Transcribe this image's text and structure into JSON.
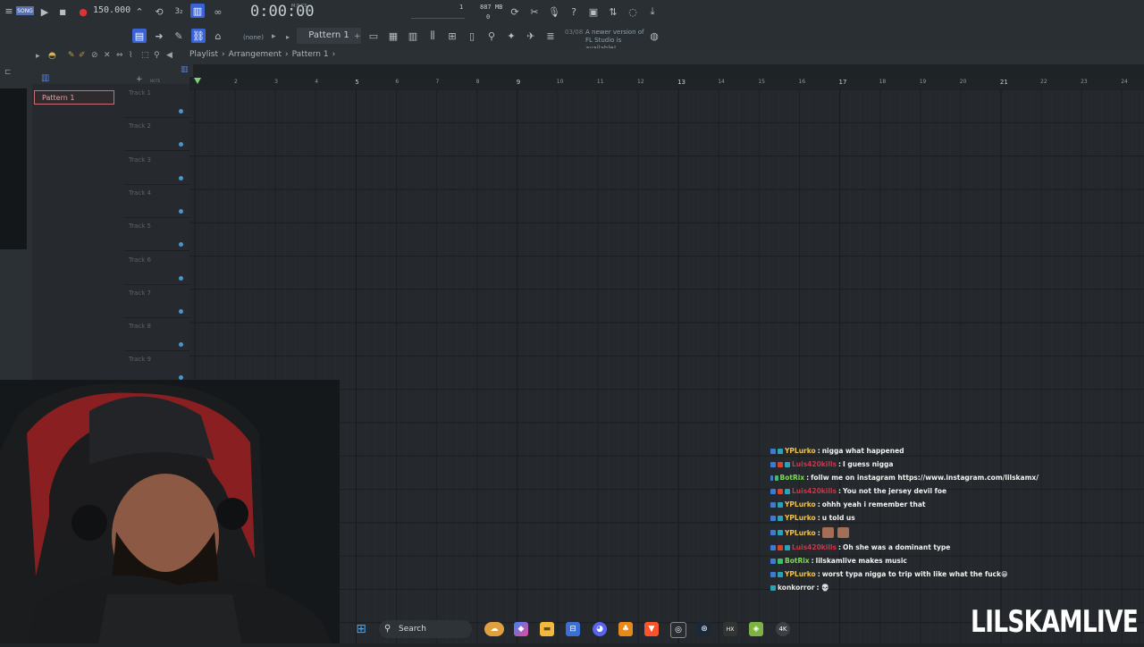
{
  "toolbar": {
    "mode_label": "SONG",
    "tempo": "150.000",
    "time_display": "0:00:00",
    "time_mode": "M:S:CS",
    "cpu_value": "1",
    "ram_label": "887 MB",
    "poly_value": "0",
    "pattern_selector": "Pattern 1",
    "snap_value": "(none)",
    "update_note_date": "03/08",
    "update_note_text": "A newer version of FL Studio is available!"
  },
  "playlist": {
    "breadcrumb": [
      "Playlist",
      "Arrangement",
      "Pattern 1"
    ],
    "pattern_items": [
      "Pattern 1"
    ],
    "tracks": [
      "Track 1",
      "Track 2",
      "Track 3",
      "Track 4",
      "Track 5",
      "Track 6",
      "Track 7",
      "Track 8",
      "Track 9"
    ],
    "bars": [
      "2",
      "3",
      "4",
      "5",
      "6",
      "7",
      "8",
      "9",
      "10",
      "11",
      "12",
      "13",
      "14",
      "15",
      "16",
      "17",
      "18",
      "19",
      "20",
      "21",
      "22",
      "23",
      "24"
    ]
  },
  "chat": [
    {
      "user": "YPLurko",
      "color": "#f0c24a",
      "text": "nigga what happened",
      "badges": [
        "#3a7bd5",
        "#2aa3b8"
      ]
    },
    {
      "user": "Luis420kills",
      "color": "#c9364a",
      "text": "I guess nigga",
      "badges": [
        "#3a7bd5",
        "#d9432e",
        "#2aa3b8"
      ]
    },
    {
      "user": "BotRix",
      "color": "#7ed957",
      "text": "follw me on instagram https://www.instagram.com/lilskamx/",
      "badges": [
        "#3a7bd5",
        "#3cbf6b"
      ]
    },
    {
      "user": "Luis420kills",
      "color": "#c9364a",
      "text": "You not the jersey devil foe",
      "badges": [
        "#3a7bd5",
        "#d9432e",
        "#2aa3b8"
      ]
    },
    {
      "user": "YPLurko",
      "color": "#f0c24a",
      "text": "ohhh yeah i remember that",
      "badges": [
        "#3a7bd5",
        "#2aa3b8"
      ]
    },
    {
      "user": "YPLurko",
      "color": "#f0c24a",
      "text": "u told us",
      "badges": [
        "#3a7bd5",
        "#2aa3b8"
      ]
    },
    {
      "user": "YPLurko",
      "color": "#f0c24a",
      "text": "",
      "emotes": 2,
      "badges": [
        "#3a7bd5",
        "#2aa3b8"
      ]
    },
    {
      "user": "Luis420kills",
      "color": "#c9364a",
      "text": "Oh she was a dominant type",
      "badges": [
        "#3a7bd5",
        "#d9432e",
        "#2aa3b8"
      ]
    },
    {
      "user": "BotRix",
      "color": "#7ed957",
      "text": "lilskamlive makes music",
      "badges": [
        "#3a7bd5",
        "#3cbf6b"
      ]
    },
    {
      "user": "YPLurko",
      "color": "#f0c24a",
      "text": "worst typa nigga to trip with like what the fuck😁",
      "badges": [
        "#3a7bd5",
        "#2aa3b8"
      ]
    },
    {
      "user": "konkorror",
      "color": "#e8e8e8",
      "text": "💀",
      "badges": [
        "#2aa3b8"
      ]
    }
  ],
  "taskbar": {
    "search_label": "Search",
    "apps": [
      "windows-start",
      "search",
      "widgets",
      "copilot",
      "file-explorer",
      "store",
      "discord",
      "fl-studio",
      "brave",
      "steam-overlay",
      "steam",
      "hyperx",
      "obs",
      "4k-video"
    ]
  },
  "overlay": {
    "brand_text": "LILSKAMLIVE"
  }
}
